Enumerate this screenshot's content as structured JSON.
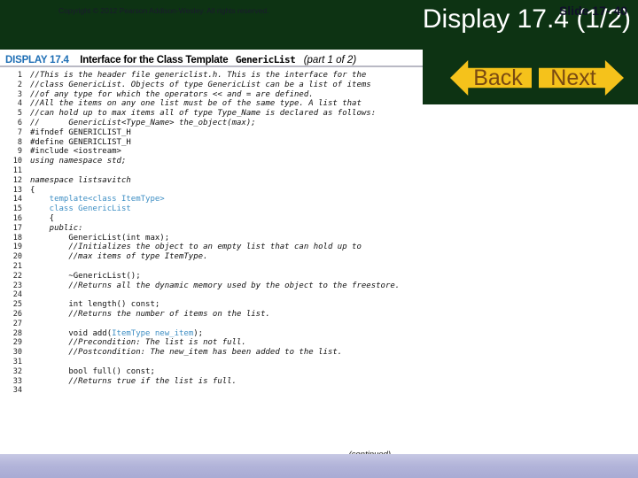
{
  "slide": {
    "title": "Display 17.4 (1/2)",
    "background_color": "#0d3313",
    "title_color": "#ffffff"
  },
  "nav": {
    "back_label": "Back",
    "next_label": "Next",
    "button_color": "#f5c21b",
    "label_color": "#7a4a12"
  },
  "display": {
    "tag": "DISPLAY 17.4",
    "tag_color": "#1f6fb5",
    "title": "Interface for the Class Template",
    "mono_name": "GenericList",
    "part": "(part 1 of 2)",
    "continued": "(continued)",
    "highlight_color": "#3f8fc4",
    "lines": [
      {
        "n": "1",
        "text": "//This is the header file genericlist.h. This is the interface for the",
        "style": "cmt"
      },
      {
        "n": "2",
        "text": "//class GenericList. Objects of type GenericList can be a list of items",
        "style": "cmt"
      },
      {
        "n": "3",
        "text": "//of any type for which the operators << and = are defined.",
        "style": "cmt"
      },
      {
        "n": "4",
        "text": "//All the items on any one list must be of the same type. A list that",
        "style": "cmt"
      },
      {
        "n": "5",
        "text": "//can hold up to max items all of type Type_Name is declared as follows:",
        "style": "cmt"
      },
      {
        "n": "6",
        "text": "//      GenericList<Type_Name> the_object(max);",
        "style": "cmt"
      },
      {
        "n": "7",
        "text": "#ifndef GENERICLIST_H",
        "style": "plain"
      },
      {
        "n": "8",
        "text": "#define GENERICLIST_H",
        "style": "plain"
      },
      {
        "n": "9",
        "text": "#include <iostream>",
        "style": "plain"
      },
      {
        "n": "10",
        "text": "using namespace std;",
        "style": "kw"
      },
      {
        "n": "11",
        "text": "",
        "style": "plain"
      },
      {
        "n": "12",
        "text": "namespace listsavitch",
        "style": "kw"
      },
      {
        "n": "13",
        "text": "{",
        "style": "plain"
      },
      {
        "n": "14",
        "text": "    template<class ItemType>",
        "style": "hl"
      },
      {
        "n": "15",
        "text": "    class GenericList",
        "style": "hl"
      },
      {
        "n": "16",
        "text": "    {",
        "style": "plain"
      },
      {
        "n": "17",
        "text": "    public:",
        "style": "kw"
      },
      {
        "n": "18",
        "text": "        GenericList(int max);",
        "style": "plain"
      },
      {
        "n": "19",
        "text": "        //Initializes the object to an empty list that can hold up to",
        "style": "cmt"
      },
      {
        "n": "20",
        "text": "        //max items of type ItemType.",
        "style": "cmt"
      },
      {
        "n": "21",
        "text": "",
        "style": "plain"
      },
      {
        "n": "22",
        "text": "        ~GenericList();",
        "style": "plain"
      },
      {
        "n": "23",
        "text": "        //Returns all the dynamic memory used by the object to the freestore.",
        "style": "cmt"
      },
      {
        "n": "24",
        "text": "",
        "style": "plain"
      },
      {
        "n": "25",
        "text": "        int length() const;",
        "style": "plain"
      },
      {
        "n": "26",
        "text": "        //Returns the number of items on the list.",
        "style": "cmt"
      },
      {
        "n": "27",
        "text": "",
        "style": "plain"
      },
      {
        "n": "28",
        "text": "        void add(ItemType new_item);",
        "style": "mixed",
        "pre": "        void add(",
        "hl": "ItemType new_item",
        "post": ");"
      },
      {
        "n": "29",
        "text": "        //Precondition: The list is not full.",
        "style": "cmt"
      },
      {
        "n": "30",
        "text": "        //Postcondition: The new_item has been added to the list.",
        "style": "cmt"
      },
      {
        "n": "31",
        "text": "",
        "style": "plain"
      },
      {
        "n": "32",
        "text": "        bool full() const;",
        "style": "plain"
      },
      {
        "n": "33",
        "text": "        //Returns true if the list is full.",
        "style": "cmt"
      },
      {
        "n": "34",
        "text": "",
        "style": "plain"
      }
    ]
  },
  "footer": {
    "copyright": "Copyright © 2012 Pearson Addison-Wesley. All rights reserved.",
    "slide_number": "Slide 17- 40",
    "bar_color": "#b3b5da"
  }
}
